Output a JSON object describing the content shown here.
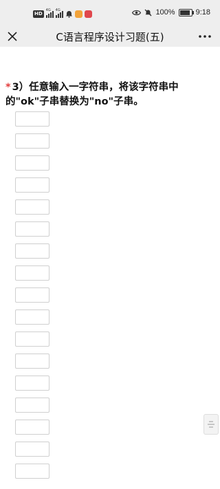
{
  "status_bar": {
    "hd_label": "HD",
    "signal_tag_1": "4G",
    "signal_tag_2": "4G",
    "battery_percent": "100%",
    "battery_level": 1.0,
    "time": "9:18",
    "icons": [
      "hd-icon",
      "signal-icon",
      "signal-icon",
      "notification-app-icon",
      "app-icon-orange",
      "app-icon-red",
      "eye-icon",
      "mute-icon",
      "battery-icon"
    ]
  },
  "nav": {
    "close_icon": "close-icon",
    "title": "C语言程序设计习题(五)",
    "more_icon": "more-icon"
  },
  "question": {
    "required_mark": "*",
    "text": "3）任意输入一字符串，将该字符串中的\"ok\"子串替换为\"no\"子串。"
  },
  "answers": {
    "count": 17,
    "values": [
      "",
      "",
      "",
      "",
      "",
      "",
      "",
      "",
      "",
      "",
      "",
      "",
      "",
      "",
      "",
      "",
      ""
    ]
  },
  "colors": {
    "bar_background": "#eeeeee",
    "required": "#e23b3b",
    "input_border": "#cfcfcf"
  }
}
